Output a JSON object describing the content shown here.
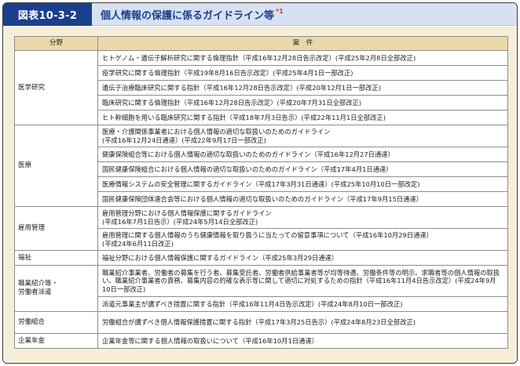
{
  "figure": {
    "label": "図表10-3-2",
    "title": "個人情報の保護に係るガイドライン等",
    "note_mark": "*1"
  },
  "table": {
    "headers": [
      "分野",
      "案　件"
    ],
    "groups": [
      {
        "category": "医学研究",
        "items": [
          [
            "ヒトゲノム・遺伝子解析研究に関する倫理指針（平成16年12月28日告示改定）(平成25年2月8日全部改正)"
          ],
          [
            "疫学研究に関する倫理指針（平成19年8月16日告示改定）(平成25年4月1日一部改正)"
          ],
          [
            "遺伝子治療臨床研究に関する指針（平成16年12月28日告示改定）(平成20年12月1日一部改正)"
          ],
          [
            "臨床研究に関する倫理指針（平成16年12月28日告示改定）(平成20年7月31日全部改正)"
          ],
          [
            "ヒト幹細胞を用いる臨床研究に関する指針（平成18年7月3日告示）(平成22年11月1日全部改正)"
          ]
        ]
      },
      {
        "category": "医療",
        "items": [
          [
            "医療・介護関係事業者における個人情報の適切な取扱いのためのガイドライン",
            "(平成16年12月24日通達）(平成22年9月17日一部改正)"
          ],
          [
            "健康保険組合等における個人情報の適切な取扱いのためのガイドライン（平成16年12月27日通達）"
          ],
          [
            "国民健康保険組合における個人情報の適切な取扱いのためのガイドライン（平成17年4月1日通達）"
          ],
          [
            "医療情報システムの安全管理に関するガイドライン（平成17年3月31日通達）(平成25年10月10日一部改定)"
          ],
          [
            "国民健康保険団体連合会等における個人情報の適切な取扱いのためのガイドライン（平成17年9月15日通達）"
          ]
        ]
      },
      {
        "category": "雇用管理",
        "items": [
          [
            "雇用管理分野における個人情報保護に関するガイドライン",
            "(平成16年7月1日告示）(平成24年5月14日全部改正)"
          ],
          [
            "雇用管理に関する個人情報のうち健康情報を取り扱うに当たっての留意事項について（平成16年10月29日通達）",
            "(平成24年6月11日改正)"
          ]
        ]
      },
      {
        "category": "福祉",
        "items": [
          [
            "福祉分野における個人情報保護に関するガイドライン（平成25年3月29日通達）"
          ]
        ]
      },
      {
        "category": "職業紹介等・\n労働者派遣",
        "items": [
          [
            "職業紹介事業者、労働者の募集を行う者、募集受託者、労働者供給事業者等が均等待遇、労働条件等の明示、求職者等の個人情報の取扱い、職業紹介事業者の責務、募集内容の的確な表示等に関して適切に対処するための指針（平成16年11月4日告示改定）(平成24年9月10日一部改正)"
          ],
          [
            "派遣元事業主が講ずべき措置に関する指針（平成16年11月4日告示改定）(平成24年8月10日一部改正)"
          ]
        ]
      },
      {
        "category": "労働組合",
        "items": [
          [
            "労働組合が講ずべき個人情報保護措置に関する指針（平成17年3月25日告示）(平成24年8月23日全部改正)"
          ]
        ]
      },
      {
        "category": "企業年金",
        "items": [
          [
            "企業年金等に関する個人情報の取扱いについて（平成16年10月1日通達）"
          ]
        ]
      }
    ]
  },
  "colors": {
    "label_bg": "#1a3f8d",
    "header_band": "#d7e1f1",
    "body_bg": "#f6eed9",
    "th_bg": "#ead9a8",
    "note_mark": "#d63a3a"
  }
}
